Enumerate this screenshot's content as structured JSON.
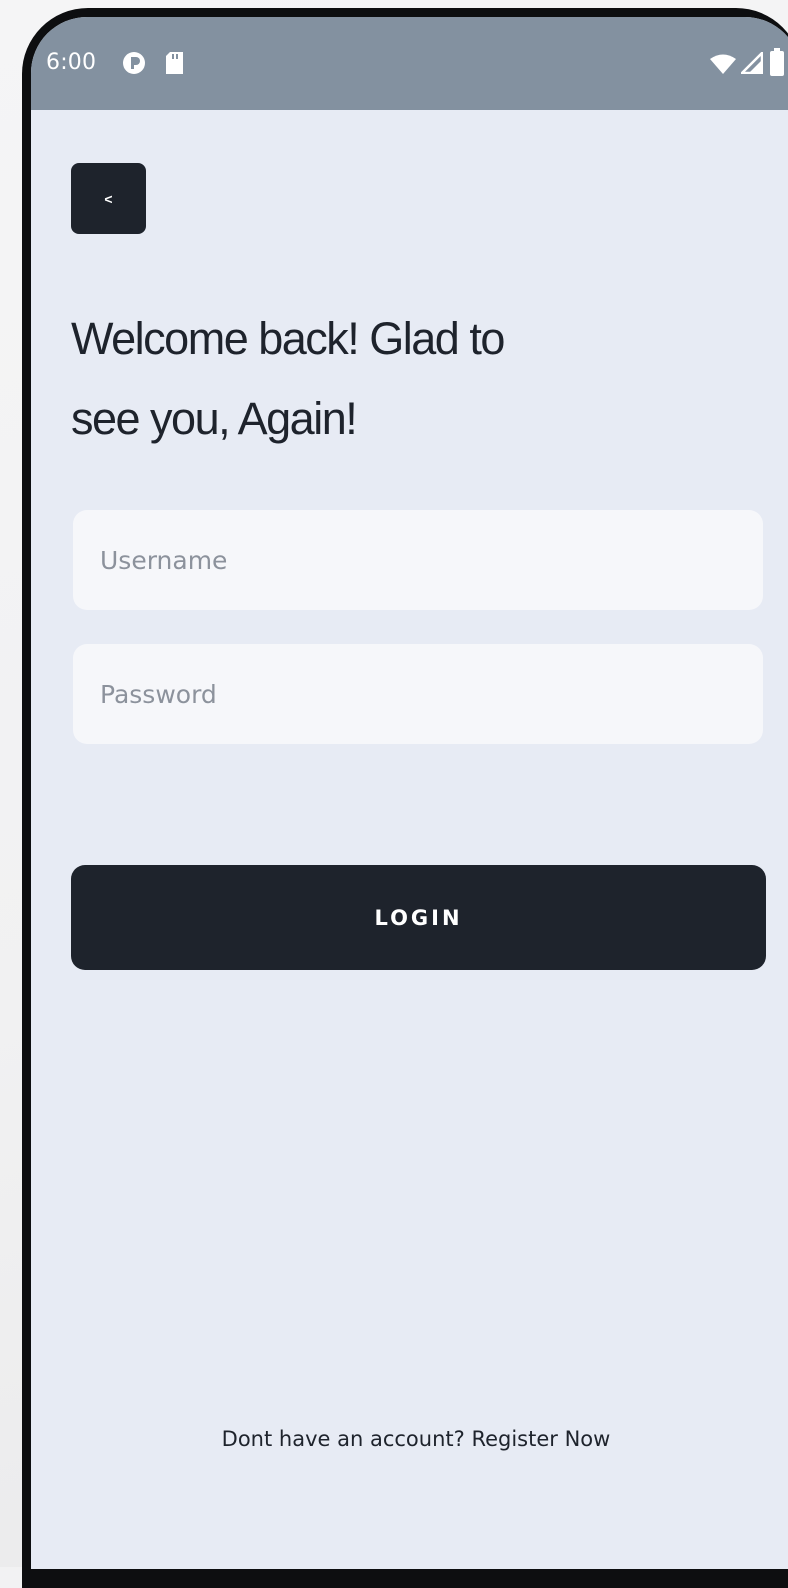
{
  "status_bar": {
    "time": "6:00",
    "left_icons": [
      "app-notification-icon",
      "sd-card-icon"
    ],
    "right_icons": [
      "wifi-icon",
      "cellular-signal-icon",
      "battery-icon"
    ],
    "background": "#8391a0"
  },
  "back_button": {
    "label": "<",
    "background": "#1e232c"
  },
  "title": {
    "line1": "Welcome back! Glad to",
    "line2": "see you, Again!"
  },
  "form": {
    "username_placeholder": "Username",
    "password_placeholder": "Password"
  },
  "login_button": {
    "label": "LOGIN",
    "background": "#1e232c"
  },
  "footer": {
    "prompt": "Dont have an account?",
    "link": "Register Now"
  },
  "colors": {
    "screen_background": "#e7ebf4",
    "field_background": "#f6f7fa",
    "text_primary": "#1e232c",
    "placeholder": "#8c929c"
  }
}
